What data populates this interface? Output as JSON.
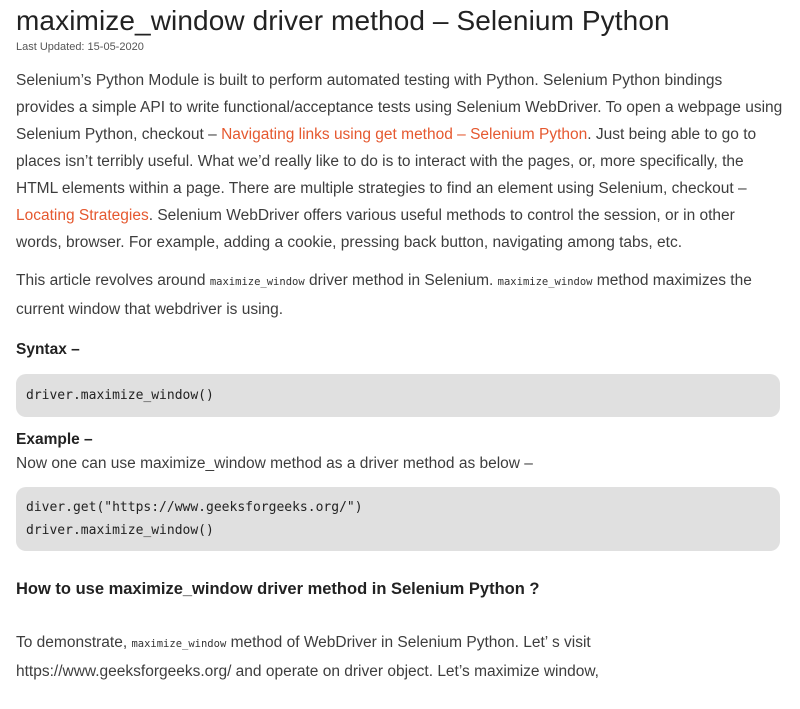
{
  "article": {
    "title": "maximize_window driver method – Selenium Python",
    "last_updated": "Last Updated: 15-05-2020",
    "intro": {
      "t1": "Selenium’s Python Module is built to perform automated testing with Python. Selenium Python bindings provides a simple API to write functional/acceptance tests using Selenium WebDriver. To open a webpage using Selenium Python, checkout – ",
      "link1": "Navigating links using get method – Selenium Python",
      "t2": ". Just being able to go to places isn’t terribly useful. What we’d really like to do is to interact with the pages, or, more specifically, the HTML elements within a page. There are multiple strategies to find an element using Selenium, checkout – ",
      "link2": "Locating Strategies",
      "t3": ". Selenium WebDriver offers various useful methods to control the session, or in other words, browser. For example, adding a cookie, pressing back button, navigating among tabs, etc."
    },
    "about": {
      "t1": "This article revolves around ",
      "code1": "maximize_window",
      "t2": " driver method in Selenium. ",
      "code2": "maximize_window",
      "t3": " method maximizes the current window that webdriver is using."
    },
    "syntax_label": "Syntax –",
    "syntax_code": "driver.maximize_window()",
    "example_label": "Example –",
    "example_desc": "Now one can use maximize_window method as a driver method as below –",
    "example_code": [
      "diver.get(\"https://www.geeksforgeeks.org/\")",
      "driver.maximize_window()"
    ],
    "howto_heading": "How to use maximize_window driver method in Selenium Python ?",
    "demo": {
      "t1": "To demonstrate, ",
      "code": "maximize_window",
      "t2": " method of WebDriver in Selenium Python. Let’ s visit https://www.geeksforgeeks.org/ and operate on driver object. Let’s maximize window,"
    }
  }
}
